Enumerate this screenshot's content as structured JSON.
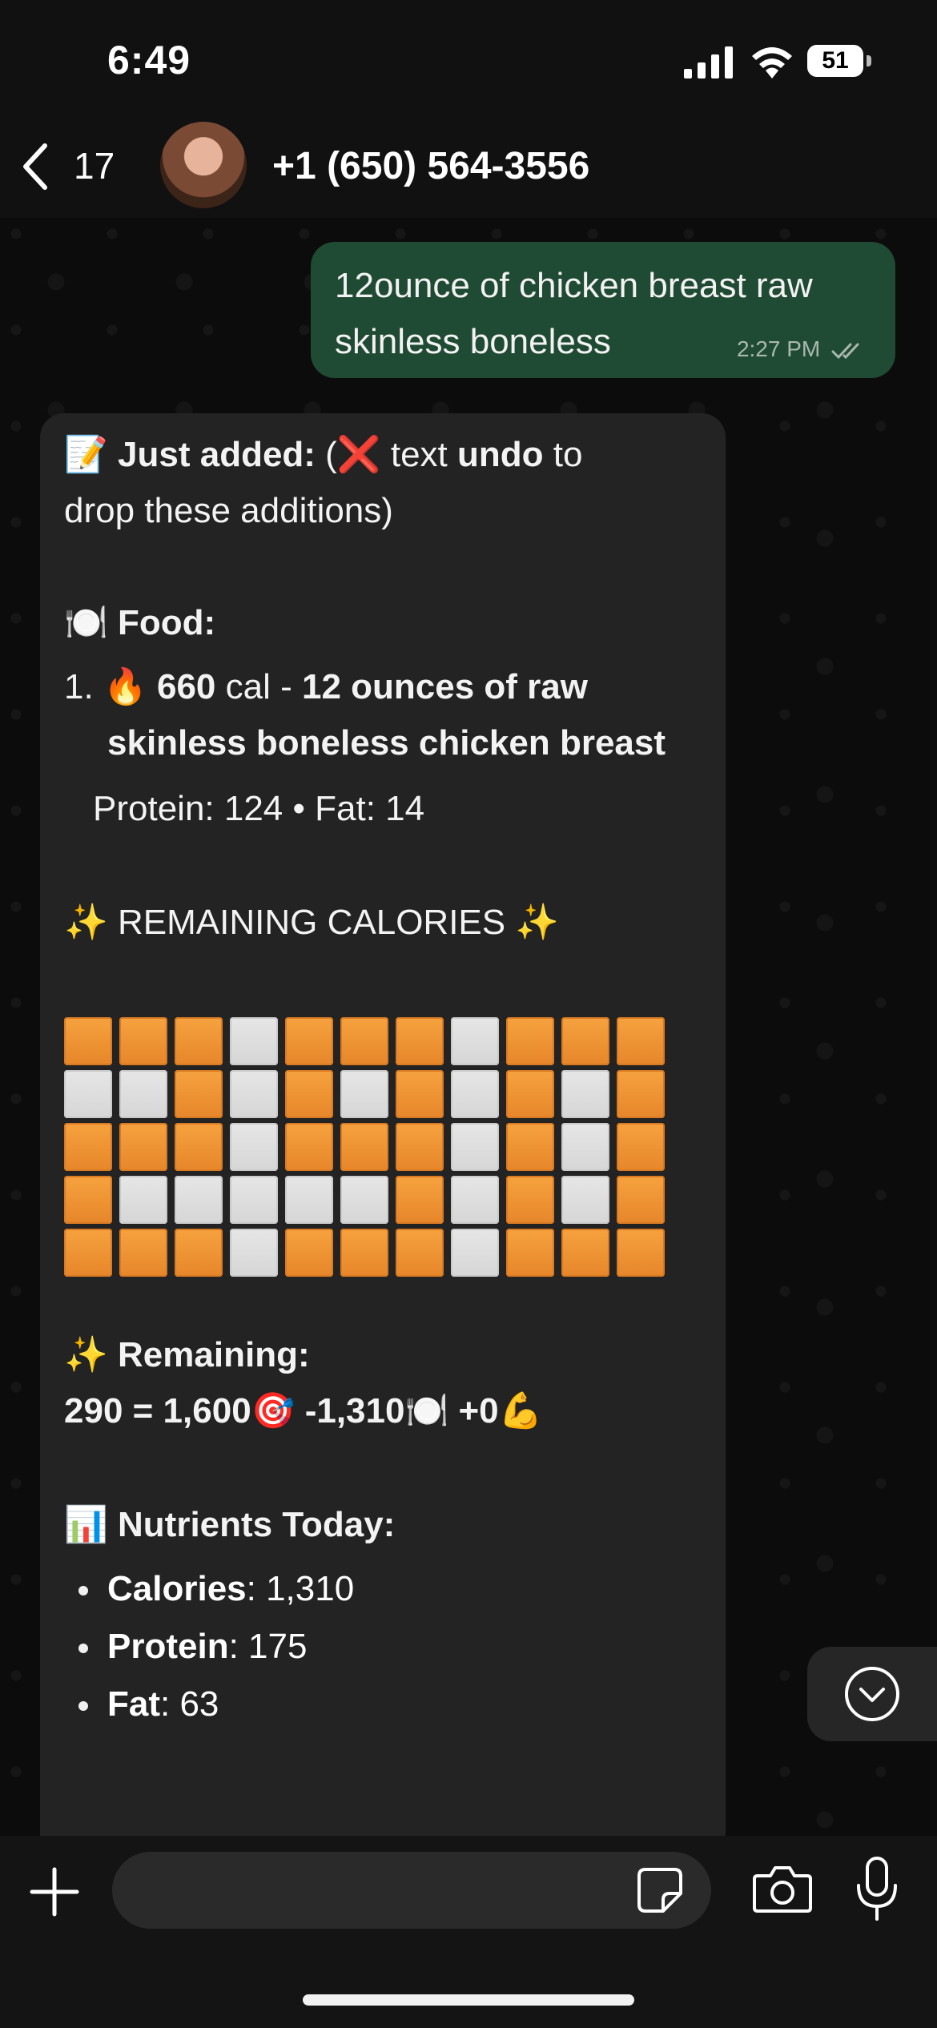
{
  "status_bar": {
    "time": "6:49",
    "battery_level": "51"
  },
  "header": {
    "back_count": "17",
    "contact_name": "+1 (650) 564-3556"
  },
  "outgoing_message": {
    "line1": "12ounce of chicken breast raw",
    "line2": "skinless boneless",
    "time": "2:27 PM"
  },
  "incoming_message": {
    "added_emoji": "📝",
    "added_label": "Just added:",
    "added_paren_open": " (",
    "cross_emoji": "❌",
    "added_text1": " text ",
    "undo_word": "undo",
    "added_text2": " to",
    "added_line2": "drop these additions)",
    "food_emoji": "🍽️",
    "food_label": "Food:",
    "item_number": "1.",
    "fire_emoji": "🔥",
    "item_cal_value": "660",
    "item_cal_unit": " cal - ",
    "item_desc_line1": "12 ounces of raw",
    "item_desc_line2": "skinless boneless chicken breast",
    "item_macros": "Protein: 124 • Fat: 14",
    "sparkle_emoji": "✨",
    "remaining_calories_heading": "REMAINING CALORIES",
    "grid_rows": [
      [
        "orange",
        "orange",
        "orange",
        "grey",
        "orange",
        "orange",
        "orange",
        "grey",
        "orange",
        "orange",
        "orange"
      ],
      [
        "grey",
        "grey",
        "orange",
        "grey",
        "orange",
        "grey",
        "orange",
        "grey",
        "orange",
        "grey",
        "orange"
      ],
      [
        "orange",
        "orange",
        "orange",
        "grey",
        "orange",
        "orange",
        "orange",
        "grey",
        "orange",
        "grey",
        "orange"
      ],
      [
        "orange",
        "grey",
        "grey",
        "grey",
        "grey",
        "grey",
        "orange",
        "grey",
        "orange",
        "grey",
        "orange"
      ],
      [
        "orange",
        "orange",
        "orange",
        "grey",
        "orange",
        "orange",
        "orange",
        "grey",
        "orange",
        "orange",
        "orange"
      ]
    ],
    "remaining_label": "Remaining:",
    "eq_part1": "290 = 1,600",
    "target_emoji": "🎯",
    "eq_part2": " -1,310",
    "plate_emoji": "🍽️",
    "eq_part3": " +0",
    "muscle_emoji": "💪",
    "chart_emoji": "📊",
    "nutrients_heading": "Nutrients Today:",
    "nutrients": [
      {
        "label": "Calories",
        "value": ": 1,310"
      },
      {
        "label": "Protein",
        "value": ": 175"
      },
      {
        "label": "Fat",
        "value": ": 63"
      }
    ]
  },
  "composer": {
    "placeholder": ""
  },
  "colors": {
    "accent_orange": "#f39c36",
    "outgoing_bubble": "#1f4a33",
    "incoming_bubble": "#222322"
  },
  "icons": [
    "back-chevron-icon",
    "signal-icon",
    "wifi-icon",
    "battery-icon",
    "read-checks-icon",
    "scroll-down-icon",
    "plus-icon",
    "sticker-icon",
    "camera-icon",
    "mic-icon"
  ]
}
